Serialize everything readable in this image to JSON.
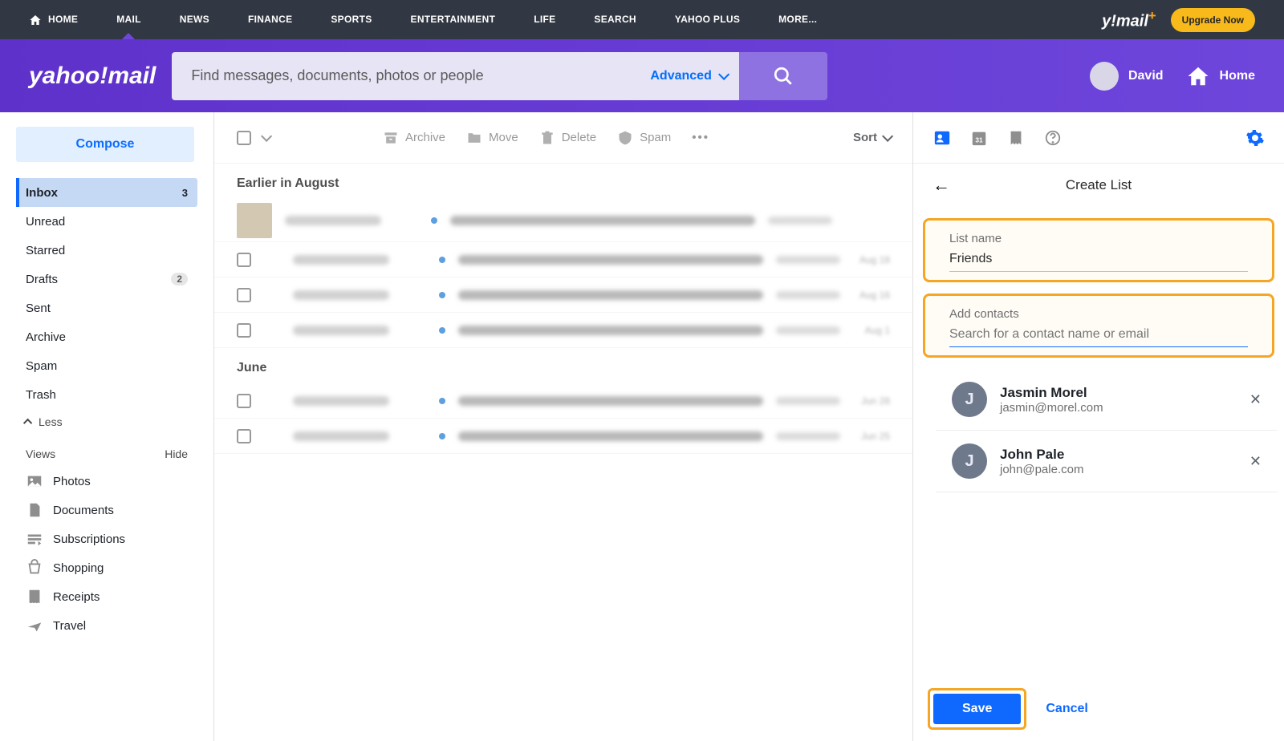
{
  "topnav": {
    "items": [
      "HOME",
      "MAIL",
      "NEWS",
      "FINANCE",
      "SPORTS",
      "ENTERTAINMENT",
      "LIFE",
      "SEARCH",
      "YAHOO PLUS",
      "MORE..."
    ],
    "logo": "y!mail",
    "upgrade": "Upgrade Now"
  },
  "header": {
    "logo": "yahoo!mail",
    "search_placeholder": "Find messages, documents, photos or people",
    "advanced": "Advanced",
    "user": "David",
    "home": "Home"
  },
  "sidebar": {
    "compose": "Compose",
    "folders": [
      {
        "label": "Inbox",
        "badge": "3",
        "active": true
      },
      {
        "label": "Unread"
      },
      {
        "label": "Starred"
      },
      {
        "label": "Drafts",
        "pill": "2"
      },
      {
        "label": "Sent"
      },
      {
        "label": "Archive"
      },
      {
        "label": "Spam"
      },
      {
        "label": "Trash"
      }
    ],
    "less": "Less",
    "views_label": "Views",
    "hide": "Hide",
    "views": [
      "Photos",
      "Documents",
      "Subscriptions",
      "Shopping",
      "Receipts",
      "Travel"
    ]
  },
  "toolbar": {
    "archive": "Archive",
    "move": "Move",
    "delete": "Delete",
    "spam": "Spam",
    "sort": "Sort"
  },
  "msg_groups": [
    {
      "label": "Earlier in August",
      "msgs": [
        {
          "date": "",
          "first": true
        },
        {
          "date": "Aug 18"
        },
        {
          "date": "Aug 16"
        },
        {
          "date": "Aug 1"
        }
      ]
    },
    {
      "label": "June",
      "msgs": [
        {
          "date": "Jun 28"
        },
        {
          "date": "Jun 25"
        }
      ]
    }
  ],
  "panel": {
    "title": "Create List",
    "list_name_label": "List name",
    "list_name_value": "Friends",
    "add_contacts_label": "Add contacts",
    "add_contacts_placeholder": "Search for a contact name or email",
    "contacts": [
      {
        "initial": "J",
        "name": "Jasmin Morel",
        "email": "jasmin@morel.com"
      },
      {
        "initial": "J",
        "name": "John Pale",
        "email": "john@pale.com"
      }
    ],
    "save": "Save",
    "cancel": "Cancel"
  }
}
